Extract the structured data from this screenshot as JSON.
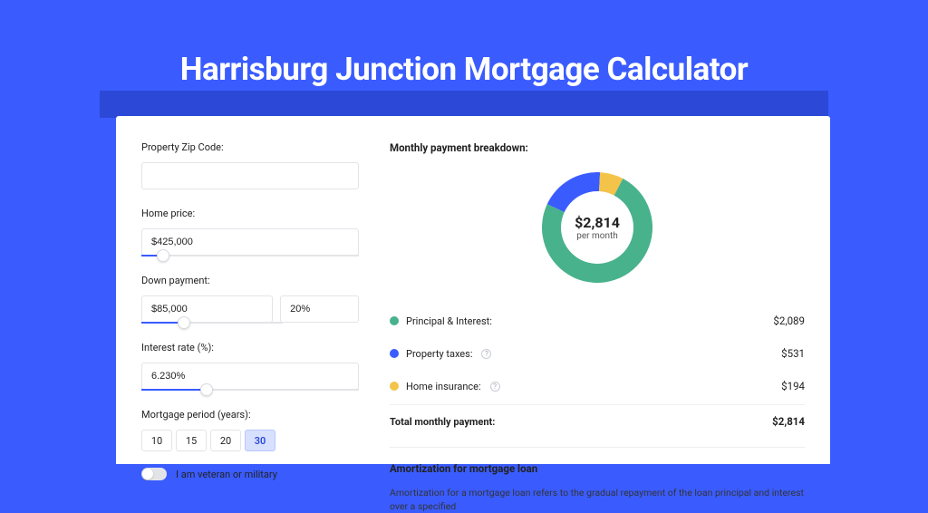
{
  "page": {
    "title": "Harrisburg Junction Mortgage Calculator"
  },
  "colors": {
    "principal": "#48b28c",
    "taxes": "#3a5cff",
    "insurance": "#f4c34a"
  },
  "form": {
    "zip": {
      "label": "Property Zip Code:",
      "value": ""
    },
    "home_price": {
      "label": "Home price:",
      "value": "$425,000",
      "slider_pct": 10
    },
    "down_payment": {
      "label": "Down payment:",
      "amount": "$85,000",
      "percent": "20%",
      "slider_pct": 20
    },
    "interest_rate": {
      "label": "Interest rate (%):",
      "value": "6.230%",
      "slider_pct": 30
    },
    "period": {
      "label": "Mortgage period (years):",
      "options": [
        "10",
        "15",
        "20",
        "30"
      ],
      "selected": "30"
    },
    "veteran": {
      "label": "I am veteran or military",
      "checked": false
    }
  },
  "breakdown": {
    "title": "Monthly payment breakdown:",
    "center_amount": "$2,814",
    "center_sub": "per month",
    "items": [
      {
        "label": "Principal & Interest:",
        "value": "$2,089",
        "color": "principal",
        "info": false
      },
      {
        "label": "Property taxes:",
        "value": "$531",
        "color": "taxes",
        "info": true
      },
      {
        "label": "Home insurance:",
        "value": "$194",
        "color": "insurance",
        "info": true
      }
    ],
    "total": {
      "label": "Total monthly payment:",
      "value": "$2,814"
    }
  },
  "chart_data": {
    "type": "pie",
    "title": "Monthly payment breakdown",
    "series": [
      {
        "name": "Principal & Interest",
        "value": 2089,
        "color": "#48b28c"
      },
      {
        "name": "Property taxes",
        "value": 531,
        "color": "#3a5cff"
      },
      {
        "name": "Home insurance",
        "value": 194,
        "color": "#f4c34a"
      }
    ],
    "total": 2814
  },
  "amortization": {
    "title": "Amortization for mortgage loan",
    "text": "Amortization for a mortgage loan refers to the gradual repayment of the loan principal and interest over a specified"
  }
}
